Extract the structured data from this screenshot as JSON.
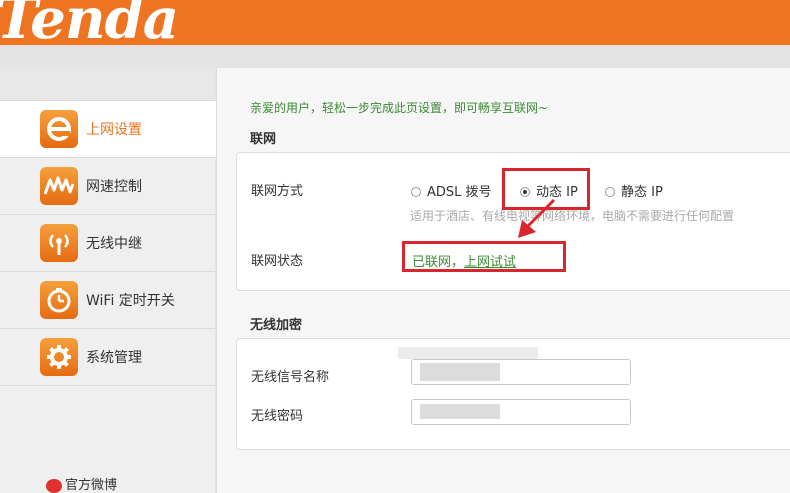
{
  "header": {
    "logo": "Tenda"
  },
  "sidebar": {
    "items": [
      {
        "label": "上网设置",
        "icon": "ie-icon",
        "active": true
      },
      {
        "label": "网速控制",
        "icon": "speed-wave-icon",
        "active": false
      },
      {
        "label": "无线中继",
        "icon": "wireless-repeater-icon",
        "active": false
      },
      {
        "label": "WiFi 定时开关",
        "icon": "timer-icon",
        "active": false
      },
      {
        "label": "系统管理",
        "icon": "gear-icon",
        "active": false
      }
    ],
    "weibo": "官方微博"
  },
  "main": {
    "greeting": "亲爱的用户，轻松一步完成此页设置，即可畅享互联网~",
    "internet": {
      "title": "联网",
      "mode_label": "联网方式",
      "options": [
        "ADSL 拨号",
        "动态 IP",
        "静态 IP"
      ],
      "selected": "动态 IP",
      "hint": "适用于酒店、有线电视等网络环境，电脑不需要进行任何配置",
      "status_label": "联网状态",
      "status_text": "已联网，",
      "status_link": "上网试试"
    },
    "wireless": {
      "title": "无线加密",
      "ssid_label": "无线信号名称",
      "password_label": "无线密码"
    }
  },
  "colors": {
    "brand": "#ee7421",
    "highlight": "#d8262c",
    "status": "#3d8b37"
  }
}
